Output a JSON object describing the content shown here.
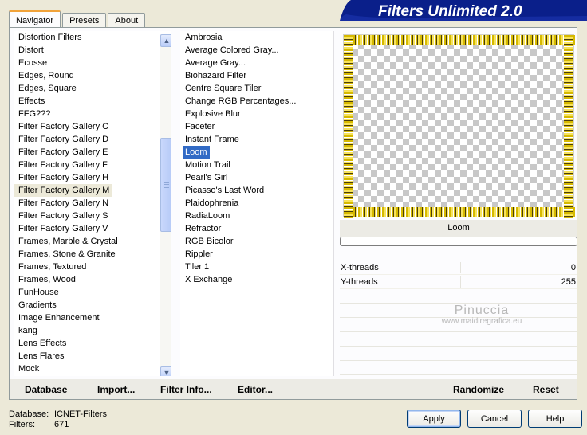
{
  "app": {
    "title": "Filters Unlimited 2.0"
  },
  "tabs": [
    {
      "label": "Navigator",
      "active": true
    },
    {
      "label": "Presets",
      "active": false
    },
    {
      "label": "About",
      "active": false
    }
  ],
  "categories": {
    "items": [
      "Distortion Filters",
      "Distort",
      "Ecosse",
      "Edges, Round",
      "Edges, Square",
      "Effects",
      "FFG???",
      "Filter Factory Gallery C",
      "Filter Factory Gallery D",
      "Filter Factory Gallery E",
      "Filter Factory Gallery F",
      "Filter Factory Gallery H",
      "Filter Factory Gallery M",
      "Filter Factory Gallery N",
      "Filter Factory Gallery S",
      "Filter Factory Gallery V",
      "Frames, Marble & Crystal",
      "Frames, Stone & Granite",
      "Frames, Textured",
      "Frames, Wood",
      "FunHouse",
      "Gradients",
      "Image Enhancement",
      "kang",
      "Lens Effects",
      "Lens Flares",
      "Mock"
    ],
    "selected": "Filter Factory Gallery M"
  },
  "filters": {
    "items": [
      "Ambrosia",
      "Average Colored Gray...",
      "Average Gray...",
      "Biohazard Filter",
      "Centre Square Tiler",
      "Change RGB Percentages...",
      "Explosive Blur",
      "Faceter",
      "Instant Frame",
      "Loom",
      "Motion Trail",
      "Pearl's Girl",
      "Picasso's Last Word",
      "Plaidophrenia",
      "RadiaLoom",
      "Refractor",
      "RGB Bicolor",
      "Rippler",
      "Tiler 1",
      "X Exchange"
    ],
    "selected": "Loom"
  },
  "preview": {
    "filter_name": "Loom"
  },
  "params": [
    {
      "label": "X-threads",
      "value": "0"
    },
    {
      "label": "Y-threads",
      "value": "255"
    }
  ],
  "watermark": {
    "name": "Pinuccia",
    "url": "www.maidiregrafica.eu"
  },
  "bottom_buttons": {
    "database": {
      "u": "D",
      "rest": "atabase"
    },
    "import": {
      "u": "I",
      "rest": "mport..."
    },
    "filter_info": {
      "pre": "Filter ",
      "u": "I",
      "rest": "nfo..."
    },
    "editor": {
      "u": "E",
      "rest": "ditor..."
    },
    "randomize": "Randomize",
    "reset": "Reset"
  },
  "status": {
    "database_label": "Database:",
    "database_value": "ICNET-Filters",
    "filters_label": "Filters:",
    "filters_value": "671"
  },
  "dialog_buttons": {
    "apply": "Apply",
    "cancel": "Cancel",
    "help": "Help"
  },
  "colors": {
    "selection": "#316ac5",
    "accent_tab": "#f1a33a",
    "banner": "#0a1f8a"
  }
}
